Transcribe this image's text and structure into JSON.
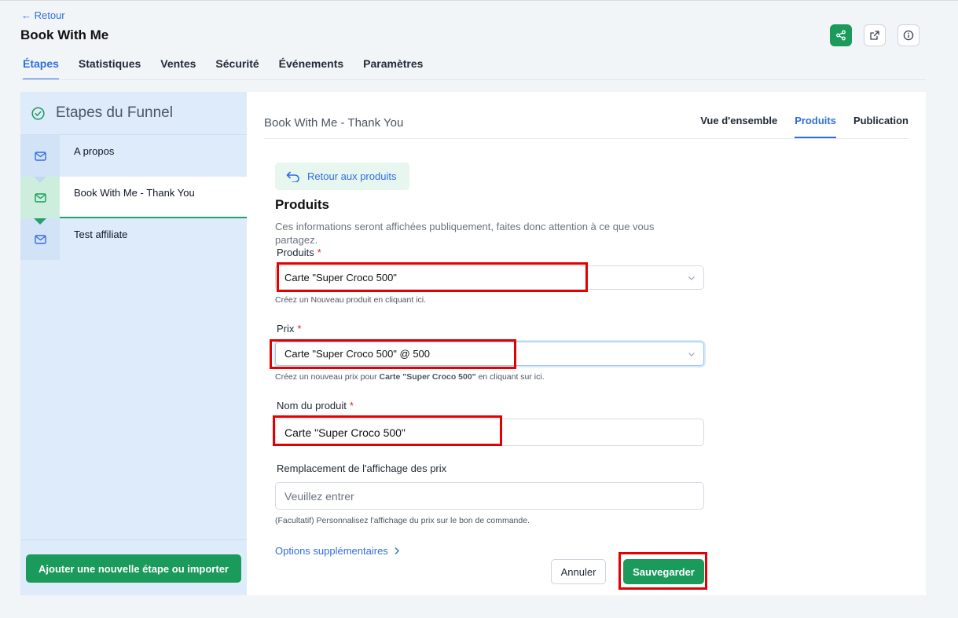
{
  "header": {
    "back_label": "← Retour",
    "title": "Book With Me",
    "nav": [
      {
        "label": "Étapes"
      },
      {
        "label": "Statistiques"
      },
      {
        "label": "Ventes"
      },
      {
        "label": "Sécurité"
      },
      {
        "label": "Événements"
      },
      {
        "label": "Paramètres"
      }
    ],
    "active_nav": "Étapes",
    "actions": [
      "share-icon",
      "external-link-icon",
      "info-icon"
    ]
  },
  "sidebar": {
    "heading": "Etapes du Funnel",
    "steps": [
      {
        "label": "A propos",
        "icon": "mail-icon"
      },
      {
        "label": "Book With Me - Thank You",
        "icon": "mail-icon"
      },
      {
        "label": "Test affiliate",
        "icon": "mail-icon"
      }
    ],
    "active_step": "Book With Me - Thank You",
    "add_button": "Ajouter une nouvelle étape ou importer"
  },
  "main": {
    "page_name": "Book With Me - Thank You",
    "tabs": [
      {
        "label": "Vue d'ensemble"
      },
      {
        "label": "Produits"
      },
      {
        "label": "Publication"
      }
    ],
    "active_tab": "Produits",
    "back_to_products": "Retour aux produits",
    "section_title": "Produits",
    "section_desc": "Ces informations seront affichées publiquement, faites donc attention à ce que vous partagez.",
    "form": {
      "product_label": "Produits",
      "product_value": "Carte \"Super Croco 500\"",
      "product_hint": "Créez un Nouveau produit en cliquant ici.",
      "price_label": "Prix",
      "price_value": "Carte \"Super Croco 500\" @ 500",
      "price_hint_pre": "Créez un nouveau prix pour ",
      "price_hint_bold": "Carte \"Super Croco 500\"",
      "price_hint_post": " en cliquant sur ici.",
      "name_label": "Nom du produit",
      "name_value": "Carte \"Super Croco 500\"",
      "override_label": "Remplacement de l'affichage des prix",
      "override_placeholder": "Veuillez entrer",
      "override_hint": "(Facultatif) Personnalisez l'affichage du prix sur le bon de commande.",
      "required_mark": "*"
    },
    "more_options": "Options supplémentaires",
    "cancel": "Annuler",
    "save": "Sauvegarder"
  },
  "colors": {
    "accent": "#2f6fdf",
    "brand_green": "#1a9a5b",
    "highlight_red": "#e40000"
  }
}
